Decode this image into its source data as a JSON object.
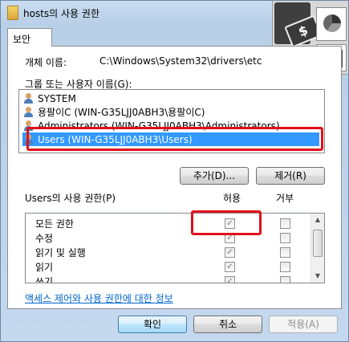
{
  "window": {
    "title": "hosts의 사용 권한"
  },
  "tabs": [
    {
      "label": "보안"
    }
  ],
  "object_name": {
    "label": "개체 이름:",
    "value": "C:\\Windows\\System32\\drivers\\etc"
  },
  "groups": {
    "label": "그룹 또는 사용자 이름(G):",
    "items": [
      {
        "label": "SYSTEM"
      },
      {
        "label": "용팔이C (WIN-G35LJJ0ABH3\\용팔이C)"
      },
      {
        "label": "Administrators (WIN-G35LJJ0ABH3\\Administrators)"
      },
      {
        "label": "Users (WIN-G35LJJ0ABH3\\Users)",
        "selected": true
      }
    ]
  },
  "buttons": {
    "add": "추가(D)...",
    "remove": "제거(R)",
    "ok": "확인",
    "cancel": "취소",
    "apply": "적용(A)"
  },
  "permissions": {
    "label": "Users의 사용 권한(P)",
    "allow_header": "허용",
    "deny_header": "거부",
    "rows": [
      {
        "name": "모든 권한",
        "allow": true,
        "deny": false
      },
      {
        "name": "수정",
        "allow": true,
        "deny": false
      },
      {
        "name": "읽기 및 실행",
        "allow": true,
        "deny": false
      },
      {
        "name": "읽기",
        "allow": true,
        "deny": false
      },
      {
        "name": "쓰기",
        "allow": true,
        "deny": false
      }
    ]
  },
  "link": "액세스 제어와 사용 권한에 대한 정보",
  "overlay_art": {
    "money_symbol": "$"
  },
  "colors": {
    "selection": "#3399ff",
    "highlight_box": "#e0101a",
    "link": "#0066cc"
  }
}
